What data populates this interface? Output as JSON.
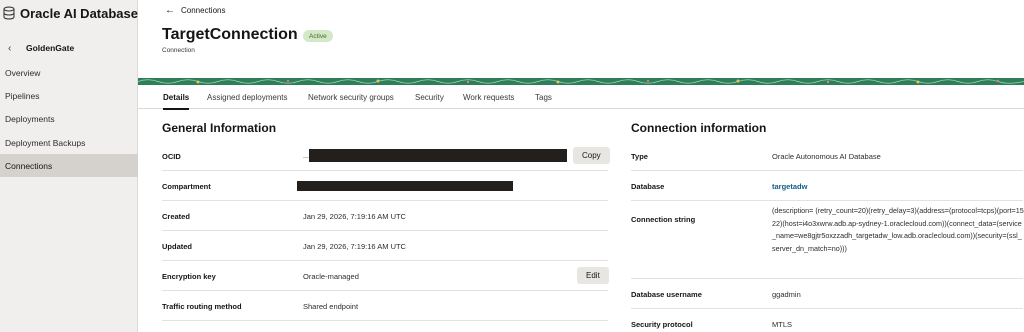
{
  "app": {
    "title": "Oracle AI Database",
    "icon": "database-icon"
  },
  "sidebar": {
    "back_label": "GoldenGate",
    "items": [
      {
        "label": "Overview",
        "active": false
      },
      {
        "label": "Pipelines",
        "active": false
      },
      {
        "label": "Deployments",
        "active": false
      },
      {
        "label": "Deployment Backups",
        "active": false
      },
      {
        "label": "Connections",
        "active": true
      }
    ]
  },
  "header": {
    "breadcrumb": "Connections",
    "title": "TargetConnection",
    "status": "Active",
    "subtitle": "Connection"
  },
  "tabs": [
    "Details",
    "Assigned deployments",
    "Network security groups",
    "Security",
    "Work requests",
    "Tags"
  ],
  "general": {
    "title": "General Information",
    "ocid_label": "OCID",
    "ocid_prefix": "...",
    "copy_label": "Copy",
    "compartment_label": "Compartment",
    "created_label": "Created",
    "created_value": "Jan 29, 2026, 7:19:16 AM UTC",
    "updated_label": "Updated",
    "updated_value": "Jan 29, 2026, 7:19:16 AM UTC",
    "encryption_label": "Encryption key",
    "encryption_value": "Oracle-managed",
    "edit_label": "Edit",
    "routing_label": "Traffic routing method",
    "routing_value": "Shared endpoint"
  },
  "connection": {
    "title": "Connection information",
    "type_label": "Type",
    "type_value": "Oracle Autonomous AI Database",
    "database_label": "Database",
    "database_value": "targetadw",
    "string_label": "Connection string",
    "string_value": "(description= (retry_count=20)(retry_delay=3)(address=(protocol=tcps)(port=1522)(host=i4o3xwrw.adb.ap-sydney-1.oraclecloud.com))(connect_data=(service_name=we8gjtr5oxzzadh_targetadw_low.adb.oraclecloud.com))(security=(ssl_server_dn_match=no)))",
    "username_label": "Database username",
    "username_value": "ggadmin",
    "protocol_label": "Security protocol",
    "protocol_value": "MTLS"
  },
  "colors": {
    "sidebar_bg": "#f1efed",
    "active_nav": "#d5d1cd",
    "badge_bg": "#d4e7c7",
    "badge_text": "#3f6b2c",
    "link": "#0f5e86",
    "banner": "#2e7d5b"
  }
}
